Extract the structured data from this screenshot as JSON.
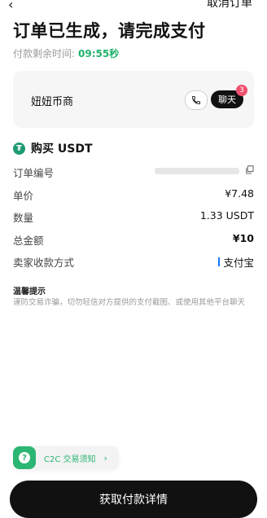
{
  "header": {
    "back_icon": "chevron-left-icon",
    "cancel_label": "取消订单",
    "title": "订单已生成，请完成支付",
    "timer_label": "付款剩余时间:",
    "timer_value": "09:55秒"
  },
  "seller": {
    "name": "妞妞币商",
    "phone_icon": "phone-icon",
    "chat_label": "聊天",
    "chat_badge": "3"
  },
  "order": {
    "asset_icon": "tether-icon",
    "asset_label": "购买 USDT",
    "rows": {
      "order_no": {
        "label": "订单编号"
      },
      "price": {
        "label": "单价",
        "value": "¥7.48"
      },
      "quantity": {
        "label": "数量",
        "value": "1.33 USDT"
      },
      "total": {
        "label": "总金额",
        "value": "¥10"
      },
      "payment": {
        "label": "卖家收款方式",
        "value": "支付宝"
      }
    }
  },
  "tips": {
    "title": "温馨提示",
    "body": "谨防交易诈骗，切勿轻信对方提供的支付截图、或使用其他平台聊天"
  },
  "notice": {
    "icon": "question-icon",
    "label": "C2C 交易须知",
    "chevron": "›"
  },
  "cta": {
    "label": "获取付款详情"
  },
  "colors": {
    "accent_green": "#20b26c",
    "cta_bg": "#111111",
    "badge": "#f0506e",
    "alipay_blue": "#1677ff"
  }
}
